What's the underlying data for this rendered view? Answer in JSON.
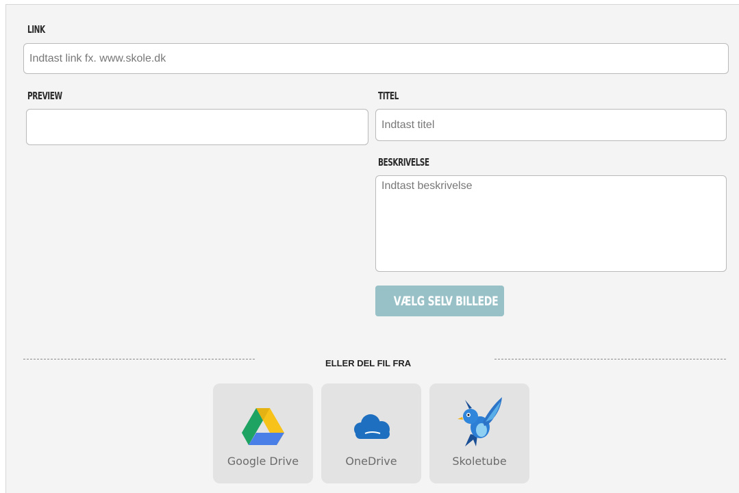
{
  "link": {
    "label": "LINK",
    "placeholder": "Indtast link fx. www.skole.dk",
    "value": ""
  },
  "preview": {
    "label": "PREVIEW"
  },
  "title": {
    "label": "TITEL",
    "placeholder": "Indtast titel",
    "value": ""
  },
  "description": {
    "label": "BESKRIVELSE",
    "placeholder": "Indtast beskrivelse",
    "value": ""
  },
  "choose_image_button": "VÆLG SELV BILLEDE",
  "divider_text": "ELLER DEL FIL FRA",
  "sources": [
    {
      "name": "Google Drive",
      "icon": "google-drive-icon"
    },
    {
      "name": "OneDrive",
      "icon": "onedrive-cloud-icon"
    },
    {
      "name": "Skoletube",
      "icon": "bluebird-icon"
    }
  ],
  "colors": {
    "button_bg": "#98c1c7",
    "panel_bg": "#f4f4f4",
    "tile_bg": "#e3e3e3",
    "onedrive_blue": "#1e6fbf"
  }
}
